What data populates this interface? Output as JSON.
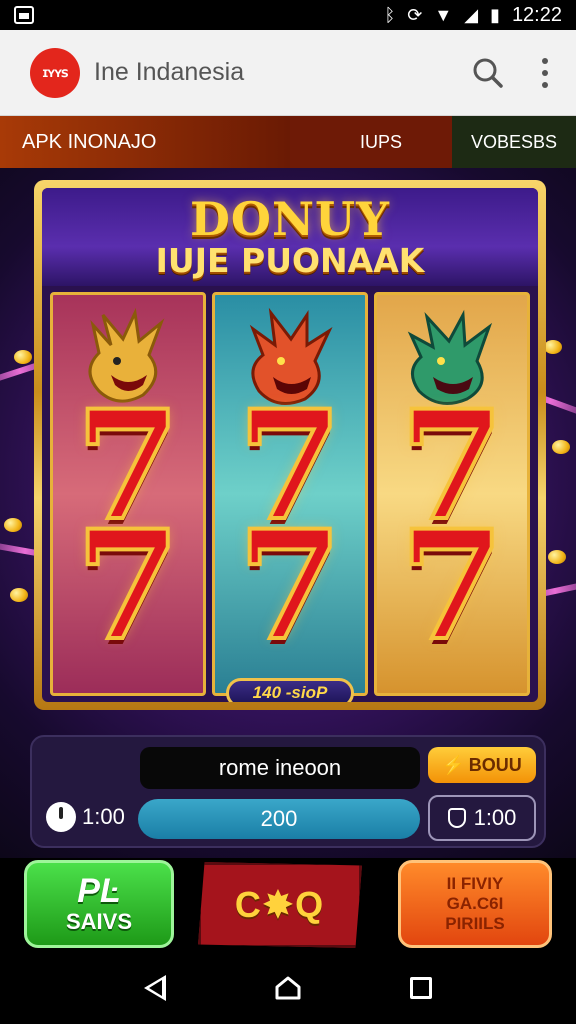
{
  "status_bar": {
    "time": "12:22"
  },
  "browser": {
    "logo_text": "ɪʏʏꜱ",
    "site_title": "Ine Indanesia"
  },
  "nav": {
    "tab_main": "APK INONAJO",
    "tab_mid": "IUPS",
    "tab_right": "VOBESBS"
  },
  "game": {
    "title_line1": "DONUY",
    "title_line2": "IUJE PUONAAK",
    "reels": [
      {
        "symbol_top": "7",
        "symbol_bottom": "7"
      },
      {
        "symbol_top": "7",
        "symbol_bottom": "7"
      },
      {
        "symbol_top": "7",
        "symbol_bottom": "7"
      }
    ],
    "plaque": "140 -sioP"
  },
  "controls": {
    "input_value": "rome ineoon",
    "bonus_label": "BOUU",
    "time_left": "1:00",
    "bet_value": "200",
    "time_right": "1:00"
  },
  "actions": {
    "green_line1": "PĿ",
    "green_line2": "SAIVS",
    "mid_label": "C✸Q",
    "orange_line1": "II FIVIY",
    "orange_line2": "GA.C6I",
    "orange_line3": "PIRIILS"
  },
  "colors": {
    "browser_logo": "#e3261c",
    "reel_border": "#e7b23a",
    "seven_red": "#e0161c",
    "bet_bar": "#1a7ea6",
    "green_button": "#1e9a18",
    "orange_button": "#e2460f"
  }
}
